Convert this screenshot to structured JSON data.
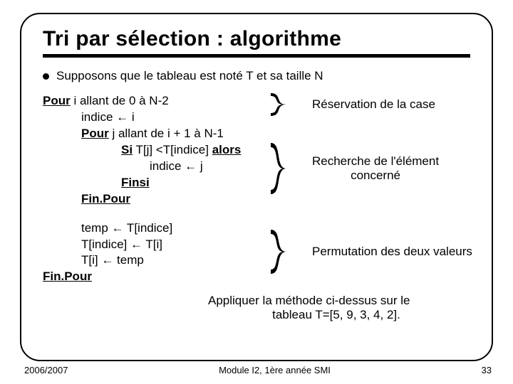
{
  "title": "Tri par sélection : algorithme",
  "intro": "Supposons que le tableau est noté T et sa taille N",
  "algo": {
    "outer_pour": "Pour",
    "outer_rest": " i allant de 0 à N-2",
    "line_indice_i": "indice ← i",
    "inner_pour": "Pour",
    "inner_rest": " j allant de i + 1 à N-1",
    "si": "Si",
    "si_mid": " T[j] <T[indice] ",
    "alors": "alors",
    "line_indice_j": "indice ← j",
    "finsi": "Finsi",
    "fin_inner": "Fin.Pour",
    "temp1": "temp ← T[indice]",
    "temp2": "T[indice] ← T[i]",
    "temp3": "T[i] ← temp",
    "fin_outer": "Fin.Pour"
  },
  "callouts": {
    "reservation": "Réservation de la case",
    "recherche_l1": "Recherche de l'élément",
    "recherche_l2": "concerné",
    "permutation": "Permutation des deux valeurs"
  },
  "exercise": {
    "l1": "Appliquer la méthode ci-dessus sur le",
    "l2": "tableau T=[5, 9, 3, 4, 2]."
  },
  "footer": {
    "left": "2006/2007",
    "center": "Module I2, 1ère année SMI",
    "right": "33"
  }
}
